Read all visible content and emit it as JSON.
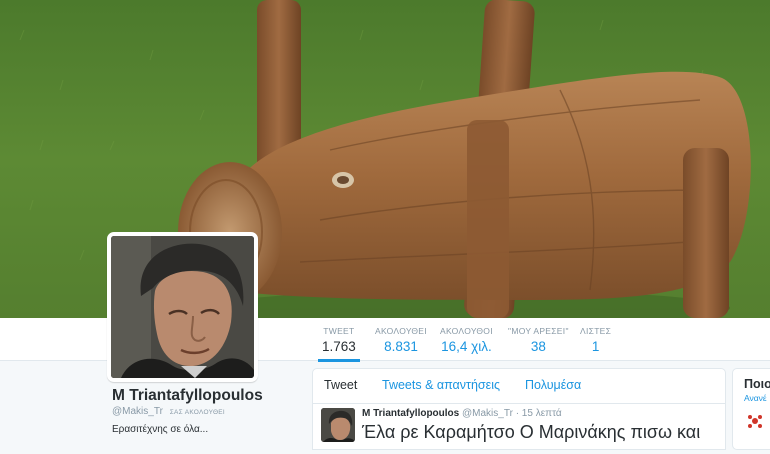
{
  "profile": {
    "display_name": "M Triantafyllopoulos",
    "handle": "@Makis_Tr",
    "follows_you": "ΣΑΣ ΑΚΟΛΟΥΘΕΙ",
    "bio": "Ερασιτέχνης σε όλα..."
  },
  "stats": [
    {
      "label": "TWEET",
      "value": "1.763"
    },
    {
      "label": "ΑΚΟΛΟΥΘΕΙ",
      "value": "8.831"
    },
    {
      "label": "ΑΚΟΛΟΥΘΟΙ",
      "value": "16,4 χιλ."
    },
    {
      "label": "\"ΜΟΥ ΑΡΕΣΕΙ\"",
      "value": "38"
    },
    {
      "label": "ΛΙΣΤΕΣ",
      "value": "1"
    }
  ],
  "timeline": {
    "tabs": [
      {
        "label": "Tweet"
      },
      {
        "label": "Tweets & απαντήσεις"
      },
      {
        "label": "Πολυμέσα"
      }
    ],
    "tweet": {
      "name": "M Triantafyllopoulos",
      "handle": "@Makis_Tr",
      "time": "· 15 λεπτά",
      "text": "Έλα ρε Καραμήτσο Ο Μαρινάκης πισω και"
    }
  },
  "sidebar": {
    "title": "Ποιο",
    "link": "Ανανέ"
  },
  "colors": {
    "accent": "#1b95e0",
    "text": "#292f33",
    "muted": "#8899a6",
    "page_background": "#f5f8fa"
  },
  "icons": {
    "sidebar": "suggestion-icon"
  }
}
